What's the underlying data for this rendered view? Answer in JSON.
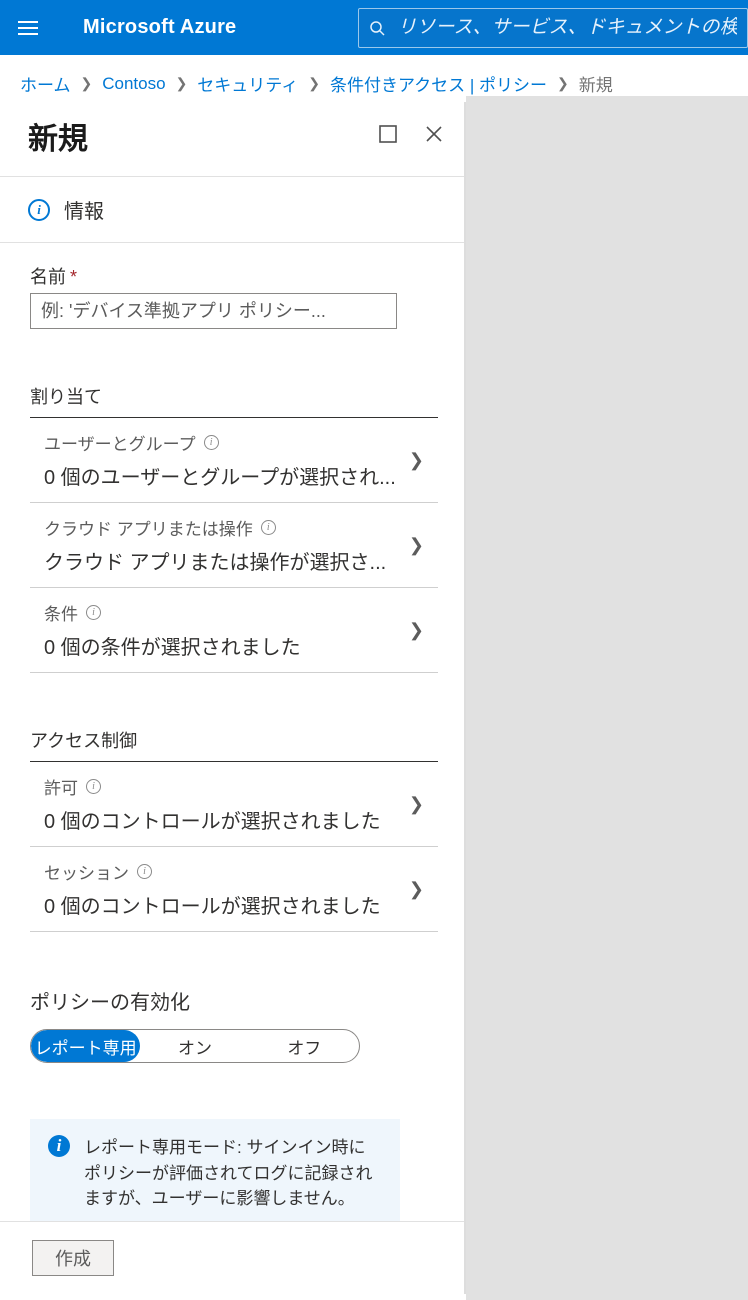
{
  "header": {
    "brand": "Microsoft Azure",
    "searchPlaceholder": "リソース、サービス、ドキュメントの検索 (G+/)"
  },
  "breadcrumb": {
    "home": "ホーム",
    "org": "Contoso",
    "security": "セキュリティ",
    "ca": "条件付きアクセス | ポリシー",
    "current": "新規"
  },
  "blade": {
    "title": "新規",
    "info": "情報"
  },
  "form": {
    "nameLabel": "名前",
    "namePlaceholder": "例: 'デバイス準拠アプリ ポリシー...",
    "section1": "割り当て",
    "item_users_title": "ユーザーとグループ",
    "item_users_sub": "0 個のユーザーとグループが選択され...",
    "item_apps_title": "クラウド アプリまたは操作",
    "item_apps_sub": "クラウド アプリまたは操作が選択さ...",
    "item_cond_title": "条件",
    "item_cond_sub": "0 個の条件が選択されました",
    "section2": "アクセス制御",
    "item_grant_title": "許可",
    "item_grant_sub": "0 個のコントロールが選択されました",
    "item_session_title": "セッション",
    "item_session_sub": "0 個のコントロールが選択されました",
    "enable_label": "ポリシーの有効化",
    "seg_report": "レポート専用",
    "seg_on": "オン",
    "seg_off": "オフ",
    "note": "レポート専用モード: サインイン時にポリシーが評価されてログに記録されますが、ユーザーに影響しません。"
  },
  "footer": {
    "create": "作成"
  }
}
